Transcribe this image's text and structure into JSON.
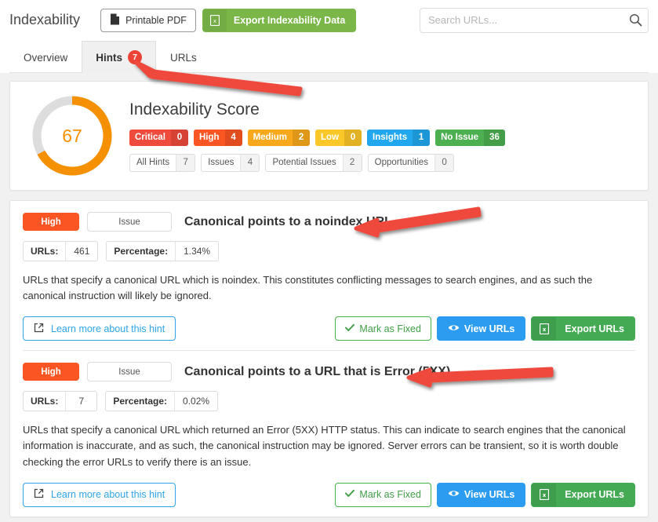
{
  "header": {
    "title": "Indexability",
    "printable_pdf_label": "Printable PDF",
    "export_data_label": "Export Indexability Data",
    "pdf_icon": "file-icon",
    "xls_icon": "spreadsheet-icon"
  },
  "search": {
    "placeholder": "Search URLs...",
    "value": "",
    "icon": "search-icon"
  },
  "tabs": [
    {
      "label": "Overview",
      "active": false,
      "badge": null
    },
    {
      "label": "Hints",
      "active": true,
      "badge": "7"
    },
    {
      "label": "URLs",
      "active": false,
      "badge": null
    }
  ],
  "score": {
    "heading": "Indexability Score",
    "value": "67",
    "percent": 67,
    "ring_color": "#f59000",
    "ring_track_color": "#dddddd",
    "severities": [
      {
        "label": "Critical",
        "count": "0",
        "color": "#ef4b3c"
      },
      {
        "label": "High",
        "count": "4",
        "color": "#fa5522"
      },
      {
        "label": "Medium",
        "count": "2",
        "color": "#f8a91b"
      },
      {
        "label": "Low",
        "count": "0",
        "color": "#fcc729"
      },
      {
        "label": "Insights",
        "count": "1",
        "color": "#21a7ee"
      },
      {
        "label": "No Issue",
        "count": "36",
        "color": "#4caf50"
      }
    ],
    "filters": [
      {
        "label": "All Hints",
        "count": "7"
      },
      {
        "label": "Issues",
        "count": "4"
      },
      {
        "label": "Potential Issues",
        "count": "2"
      },
      {
        "label": "Opportunities",
        "count": "0"
      }
    ]
  },
  "hints": [
    {
      "severity": "High",
      "severity_color": "#fa5522",
      "type": "Issue",
      "title": "Canonical points to a noindex URL",
      "urls_label": "URLs:",
      "urls_value": "461",
      "percentage_label": "Percentage:",
      "percentage_value": "1.34%",
      "description": "URLs that specify a canonical URL which is noindex. This constitutes conflicting messages to search engines, and as such the canonical instruction will likely be ignored.",
      "learn_more_label": "Learn more about this hint",
      "mark_fixed_label": "Mark as Fixed",
      "view_urls_label": "View URLs",
      "export_urls_label": "Export URLs"
    },
    {
      "severity": "High",
      "severity_color": "#fa5522",
      "type": "Issue",
      "title": "Canonical points to a URL that is Error (5XX)",
      "urls_label": "URLs:",
      "urls_value": "7",
      "percentage_label": "Percentage:",
      "percentage_value": "0.02%",
      "description": "URLs that specify a canonical URL which returned an Error (5XX) HTTP status. This can indicate to search engines that the canonical information is inaccurate, and as such, the canonical instruction may be ignored. Server errors can be transient, so it is worth double checking the error URLs to verify there is an issue.",
      "learn_more_label": "Learn more about this hint",
      "mark_fixed_label": "Mark as Fixed",
      "view_urls_label": "View URLs",
      "export_urls_label": "Export URLs"
    }
  ],
  "annotations": {
    "arrow_color": "#ef4a3c",
    "arrows": [
      {
        "name": "arrow-to-hints-tab",
        "target": "Hints tab"
      },
      {
        "name": "arrow-to-hint-title-1",
        "target": "Canonical points to a noindex URL"
      },
      {
        "name": "arrow-to-hint-title-2",
        "target": "Canonical points to a URL that is Error (5XX)"
      }
    ]
  },
  "icons": {
    "check": "check-icon",
    "eye": "eye-icon",
    "external_link": "external-link-icon"
  }
}
